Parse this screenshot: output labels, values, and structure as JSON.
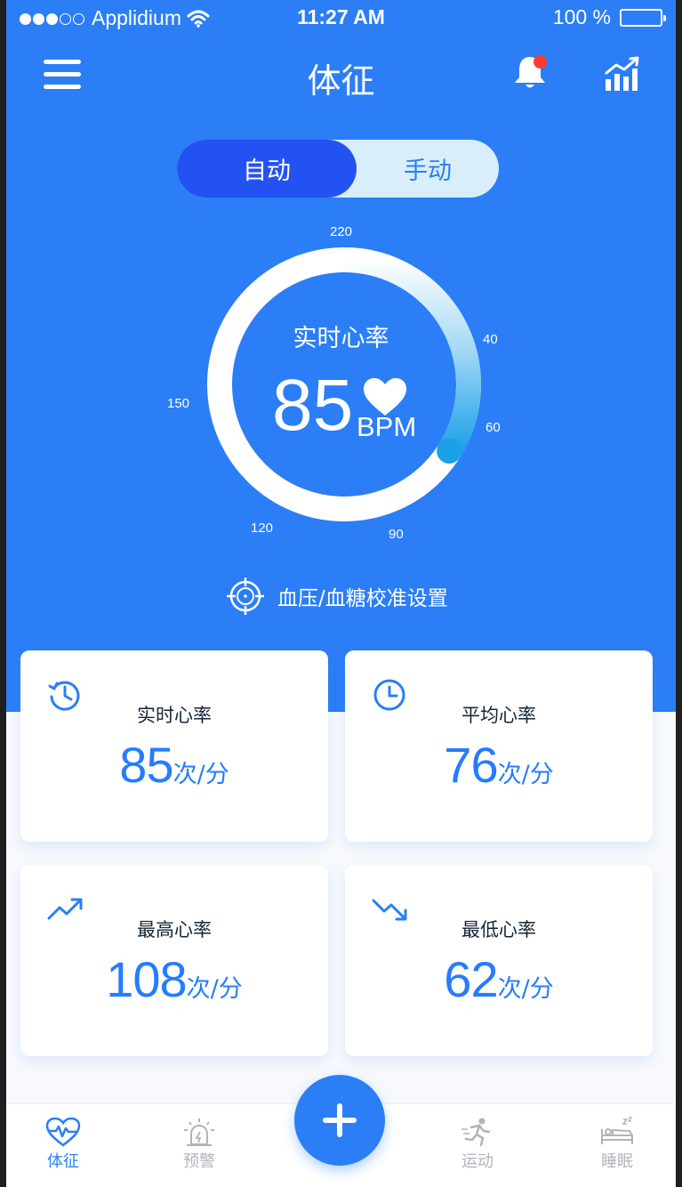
{
  "status_bar": {
    "carrier": "Applidium",
    "time": "11:27 AM",
    "battery": "100 %"
  },
  "header": {
    "title": "体征"
  },
  "mode_toggle": {
    "auto": "自动",
    "manual": "手动"
  },
  "gauge": {
    "label": "实时心率",
    "value": "85",
    "unit": "BPM",
    "ticks": [
      "220",
      "40",
      "60",
      "90",
      "120",
      "150"
    ],
    "progress": 0.34
  },
  "calibrate": {
    "label": "血压/血糖校准设置"
  },
  "cards": [
    {
      "title": "实时心率",
      "value": "85",
      "unit": "次/分",
      "icon": "clock-history-icon"
    },
    {
      "title": "平均心率",
      "value": "76",
      "unit": "次/分",
      "icon": "clock-icon"
    },
    {
      "title": "最高心率",
      "value": "108",
      "unit": "次/分",
      "icon": "trend-up-icon"
    },
    {
      "title": "最低心率",
      "value": "62",
      "unit": "次/分",
      "icon": "trend-down-icon"
    }
  ],
  "tab_bar": [
    {
      "label": "体征",
      "icon": "heart-pulse-icon",
      "active": true
    },
    {
      "label": "预警",
      "icon": "alarm-light-icon",
      "active": false
    },
    {
      "label": "运动",
      "icon": "runner-icon",
      "active": false
    },
    {
      "label": "睡眠",
      "icon": "bed-icon",
      "active": false
    }
  ],
  "colors": {
    "primary": "#2b7ef6",
    "value_blue": "#257cff",
    "title_dark": "#152537",
    "toggle_active": "#2452f2",
    "toggle_track": "#d8eefb",
    "badge": "#ff3b30"
  }
}
